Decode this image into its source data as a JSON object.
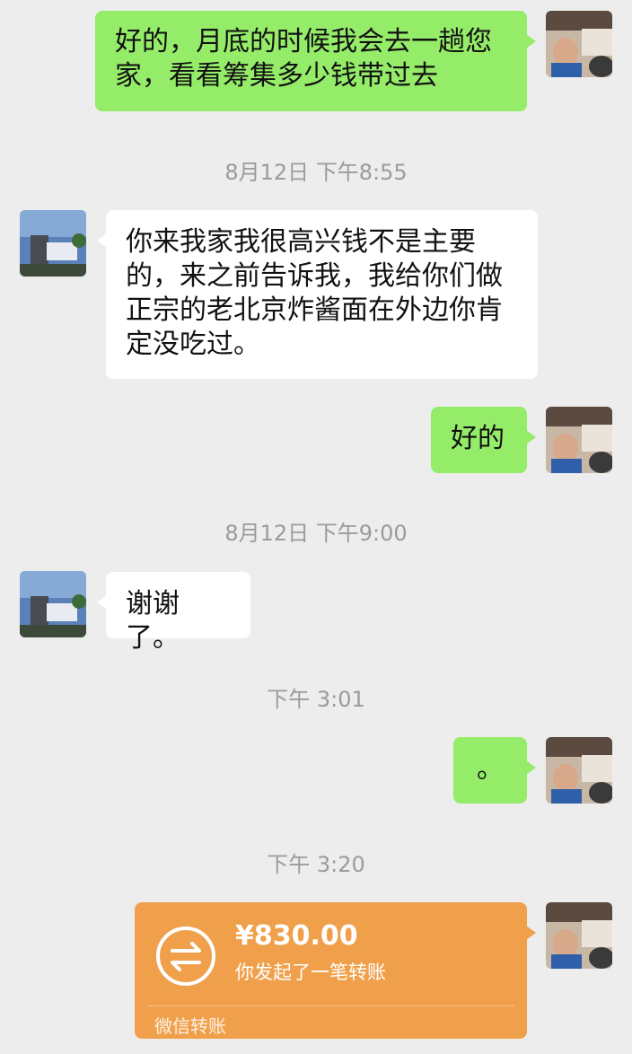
{
  "messages": {
    "m1": "好的，月底的时候我会去一趟您家，看看筹集多少钱带过去",
    "t1": "8月12日 下午8:55",
    "m2": "你来我家我很高兴钱不是主要的，来之前告诉我，我给你们做正宗的老北京炸酱面在外边你肯定没吃过。",
    "m3": "好的",
    "t2": "8月12日 下午9:00",
    "m4": "谢谢了。",
    "t3": "下午 3:01",
    "m5": "。",
    "t4": "下午 3:20"
  },
  "transfer": {
    "amount": "¥830.00",
    "description": "你发起了一笔转账",
    "footer": "微信转账",
    "icon": "transfer-arrows-icon"
  },
  "colors": {
    "background": "#ededed",
    "my_bubble": "#95ec69",
    "other_bubble": "#ffffff",
    "transfer_card": "#f0a04b",
    "timestamp": "#9b9b9b"
  }
}
